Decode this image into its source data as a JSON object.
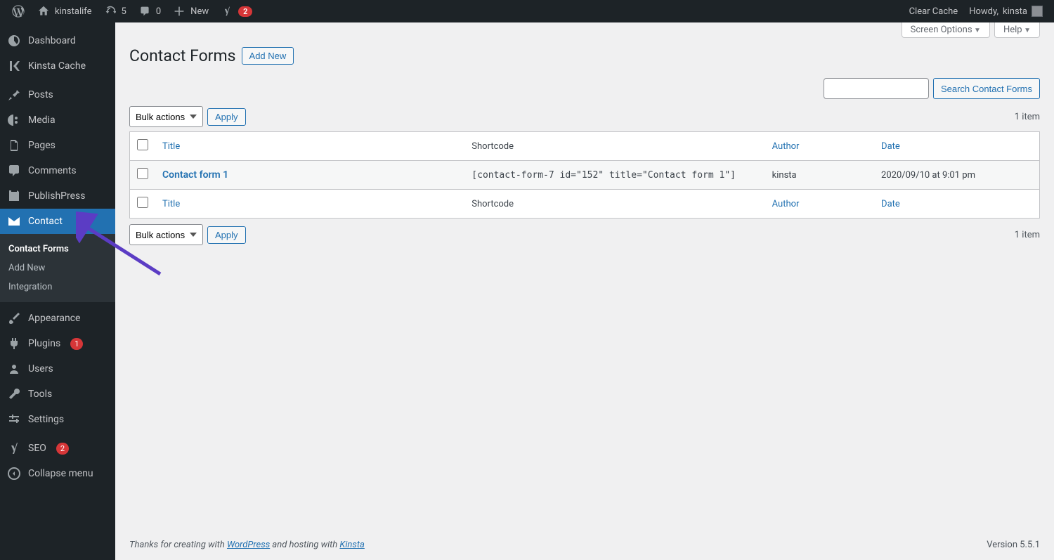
{
  "adminbar": {
    "site_name": "kinstalife",
    "updates_count": "5",
    "comments_count": "0",
    "new_label": "New",
    "yoast_badge": "2",
    "clear_cache": "Clear Cache",
    "howdy_prefix": "Howdy, ",
    "username": "kinsta"
  },
  "sidebar": {
    "dashboard": "Dashboard",
    "kinsta_cache": "Kinsta Cache",
    "posts": "Posts",
    "media": "Media",
    "pages": "Pages",
    "comments": "Comments",
    "publishpress": "PublishPress",
    "contact": "Contact",
    "appearance": "Appearance",
    "plugins": "Plugins",
    "plugins_count": "1",
    "users": "Users",
    "tools": "Tools",
    "settings": "Settings",
    "seo": "SEO",
    "seo_count": "2",
    "collapse": "Collapse menu",
    "submenu": {
      "contact_forms": "Contact Forms",
      "add_new": "Add New",
      "integration": "Integration"
    }
  },
  "screen_tabs": {
    "screen_options": "Screen Options",
    "help": "Help"
  },
  "page": {
    "title": "Contact Forms",
    "add_new": "Add New",
    "search_button": "Search Contact Forms",
    "bulk_label": "Bulk actions",
    "apply": "Apply",
    "items_count": "1 item"
  },
  "table": {
    "headers": {
      "title": "Title",
      "shortcode": "Shortcode",
      "author": "Author",
      "date": "Date"
    },
    "rows": [
      {
        "title": "Contact form 1",
        "shortcode": "[contact-form-7 id=\"152\" title=\"Contact form 1\"]",
        "author": "kinsta",
        "date": "2020/09/10 at 9:01 pm"
      }
    ]
  },
  "footer": {
    "thanks_prefix": "Thanks for creating with ",
    "wordpress": "WordPress",
    "hosting_middle": " and hosting with ",
    "kinsta": "Kinsta",
    "version": "Version 5.5.1"
  }
}
